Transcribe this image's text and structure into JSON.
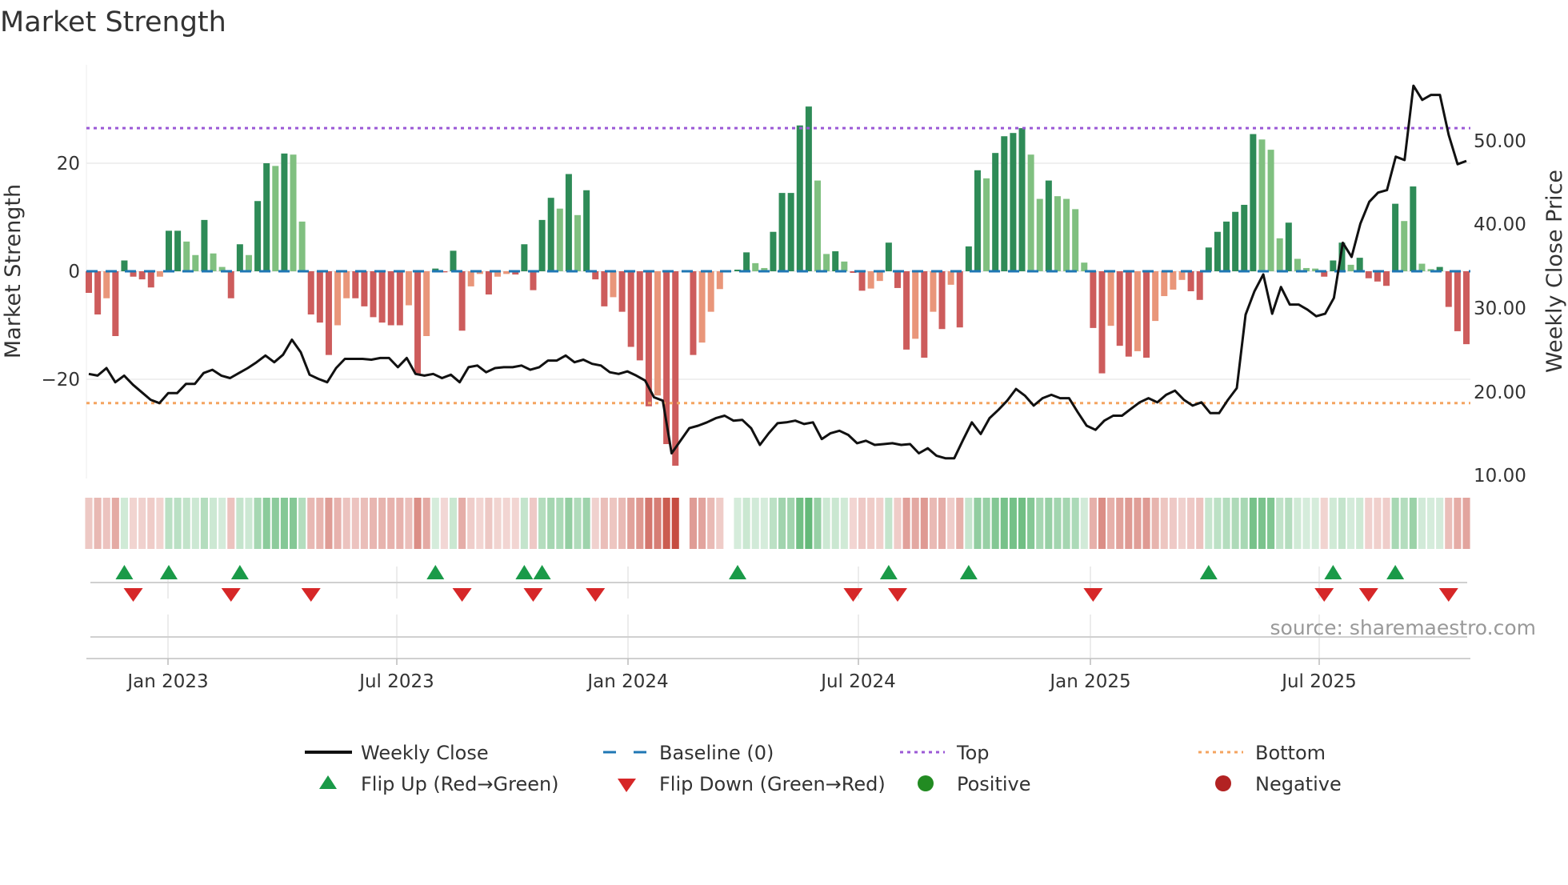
{
  "chart_data": {
    "type": "bar",
    "title": "Market Strength",
    "ylabel": "Market Strength",
    "y2label": "Weekly Close Price",
    "ylim": [
      -38.3,
      38.1
    ],
    "y2lim": [
      10.0,
      59.5
    ],
    "yticks": [
      "20",
      "0",
      "−20"
    ],
    "y2ticks": [
      "50.00",
      "40.00",
      "30.00",
      "20.00",
      "10.00"
    ],
    "xticks": [
      "Jan 2023",
      "Jul 2023",
      "Jan 2024",
      "Jul 2024",
      "Jan 2025",
      "Jul 2025"
    ],
    "top_level": 26.5,
    "bottom_level": -24.4,
    "baseline": 0,
    "source": "source: sharemaestro.com",
    "strength": [
      -4,
      -8,
      -5,
      -12,
      2,
      -1,
      -1.5,
      -3,
      -1,
      7.5,
      7.5,
      5.5,
      3,
      9.5,
      3.3,
      0.8,
      -5,
      5,
      3,
      13,
      20,
      19.5,
      21.8,
      21.6,
      9.2,
      -8,
      -9.5,
      -15.5,
      -10,
      -5,
      -5,
      -6.5,
      -8.5,
      -9.5,
      -10,
      -10,
      -6.3,
      -19,
      -12,
      0.5,
      -0.2,
      3.8,
      -11,
      -2.8,
      -0.5,
      -4.3,
      -1,
      -0.5,
      -0.6,
      5,
      -3.5,
      9.5,
      13.6,
      11.6,
      18,
      10.4,
      15,
      -1.5,
      -6.5,
      -4.8,
      -7.5,
      -14,
      -16.5,
      -25,
      -23,
      -32,
      -36,
      0,
      -15.5,
      -13.2,
      -7.5,
      -3.3,
      0,
      0.3,
      3.5,
      1.5,
      0.6,
      7.3,
      14.5,
      14.5,
      27,
      30.5,
      16.8,
      3.2,
      3.7,
      1.8,
      -0.3,
      -3.6,
      -3.2,
      -1.8,
      5.3,
      -3.1,
      -14.5,
      -12.5,
      -16,
      -7.5,
      -10.7,
      -2.5,
      -10.4,
      4.6,
      18.7,
      17.2,
      21.9,
      25,
      25.6,
      26.5,
      21.6,
      13.4,
      16.8,
      13.9,
      13.4,
      11.5,
      1.6,
      -10.5,
      -18.9,
      -10.1,
      -13.8,
      -15.8,
      -14.8,
      -16,
      -9.2,
      -4.6,
      -3.4,
      -1.6,
      -3.7,
      -5.3,
      4.4,
      7.3,
      9.2,
      11,
      12.3,
      25.4,
      24.4,
      22.5,
      6.1,
      9,
      2.3,
      0.6,
      0.5,
      -1,
      2,
      5.3,
      1.2,
      2.5,
      -1.3,
      -1.9,
      -2.7,
      12.5,
      9.3,
      15.7,
      1.4,
      0.4,
      0.8,
      -6.6,
      -11.1,
      -13.5
    ],
    "weekly_close": [
      22.1,
      21.9,
      22.8,
      21.1,
      21.9,
      20.8,
      19.9,
      19.0,
      18.6,
      19.8,
      19.8,
      20.9,
      20.9,
      22.2,
      22.6,
      21.9,
      21.6,
      22.2,
      22.8,
      23.5,
      24.3,
      23.5,
      24.4,
      26.2,
      24.7,
      22.0,
      21.5,
      21.1,
      22.8,
      23.9,
      23.9,
      23.9,
      23.8,
      24.0,
      24.0,
      22.9,
      24.0,
      22.1,
      21.9,
      22.1,
      21.6,
      22.0,
      21.1,
      22.9,
      23.1,
      22.3,
      22.8,
      22.9,
      22.9,
      23.1,
      22.6,
      22.9,
      23.7,
      23.7,
      24.3,
      23.5,
      23.8,
      23.3,
      23.1,
      22.3,
      22.1,
      22.4,
      21.9,
      21.3,
      19.3,
      18.9,
      12.6,
      14.1,
      15.6,
      15.9,
      16.3,
      16.8,
      17.1,
      16.5,
      16.6,
      15.6,
      13.6,
      15.0,
      16.2,
      16.3,
      16.5,
      16.1,
      16.3,
      14.3,
      15.0,
      15.3,
      14.8,
      13.8,
      14.1,
      13.6,
      13.7,
      13.8,
      13.6,
      13.7,
      12.6,
      13.2,
      12.3,
      12.0,
      12.0,
      14.2,
      16.3,
      14.9,
      16.8,
      17.8,
      18.9,
      20.3,
      19.5,
      18.3,
      19.2,
      19.6,
      19.2,
      19.2,
      17.5,
      15.9,
      15.4,
      16.5,
      17.1,
      17.1,
      17.9,
      18.7,
      19.2,
      18.7,
      19.6,
      20.1,
      19.0,
      18.3,
      18.7,
      17.4,
      17.4,
      19.0,
      20.4,
      29.2,
      32.0,
      34.0,
      29.3,
      32.5,
      30.4,
      30.4,
      29.8,
      29.0,
      29.3,
      31.2,
      37.8,
      36.1,
      40.1,
      42.7,
      43.8,
      44.1,
      48.1,
      47.7,
      56.6,
      54.9,
      55.5,
      55.5,
      50.7,
      47.2,
      47.6
    ],
    "flip_up_weeks": [
      4,
      9,
      17,
      39,
      49,
      51,
      73,
      90,
      99,
      126,
      140,
      147
    ],
    "flip_down_weeks": [
      5,
      16,
      25,
      42,
      50,
      57,
      86,
      91,
      113,
      139,
      144,
      153
    ],
    "legend": {
      "weekly_close": "Weekly Close",
      "baseline": "Baseline (0)",
      "top": "Top",
      "bottom": "Bottom",
      "flip_up": "Flip Up (Red→Green)",
      "flip_down": "Flip Down (Green→Red)",
      "positive": "Positive",
      "negative": "Negative"
    },
    "legend_placement": "bottom",
    "colors": {
      "rising_positive": "#2e8b57",
      "falling_positive": "#80c080",
      "falling_negative": "#cd5c5c",
      "rising_negative": "#e9967a",
      "line": "#111111",
      "baseline": "#1f77b4",
      "top": "#9b59d6",
      "bottom": "#f4a460",
      "flip_up": "#1a9a48",
      "flip_down": "#d62728",
      "positive": "#228b22",
      "negative": "#b22222"
    }
  }
}
